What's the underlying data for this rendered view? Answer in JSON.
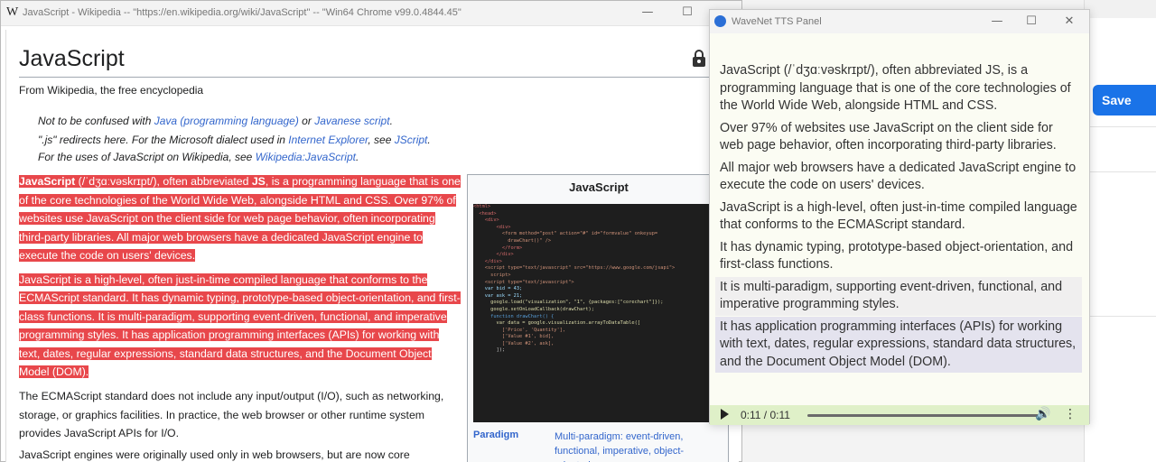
{
  "browser": {
    "window_title": "JavaScript - Wikipedia -- \"https://en.wikipedia.org/wiki/JavaScript\" -- \"Win64 Chrome v99.0.4844.45\"",
    "logo_letter": "W",
    "min_glyph": "—",
    "max_glyph": "☐"
  },
  "article": {
    "title": "JavaScript",
    "subtitle": "From Wikipedia, the free encyclopedia",
    "hatnote1": {
      "pre": "Not to be confused with ",
      "link1": "Java (programming language)",
      "mid": " or ",
      "link2": "Javanese script",
      "post": "."
    },
    "hatnote2": {
      "pre": "\".js\" redirects here. For the Microsoft dialect used in ",
      "link1": "Internet Explorer",
      "mid": ", see ",
      "link2": "JScript",
      "post": "."
    },
    "hatnote3": {
      "pre": "For the uses of JavaScript on Wikipedia, see ",
      "link1": "Wikipedia:JavaScript",
      "post": "."
    },
    "lead1": {
      "b1": "JavaScript",
      "t1": " (/ˈdʒɑːvəskrɪpt/), often abbreviated ",
      "b2": "JS",
      "t2": ", is a programming language that is one of the core technologies of the World Wide Web, alongside HTML and CSS. Over 97% of websites use JavaScript on the client side for web page behavior, often incorporating third-party libraries. All major web browsers have a dedicated JavaScript engine to execute the code on users' devices."
    },
    "lead2": "JavaScript is a high-level, often just-in-time compiled language that conforms to the ECMAScript standard. It has dynamic typing, prototype-based object-orientation, and first-class functions. It is multi-paradigm, supporting event-driven, functional, and imperative programming styles. It has application programming interfaces (APIs) for working with text, dates, regular expressions, standard data structures, and the Document Object Model (DOM).",
    "para3": {
      "t1": "The ECMAScript standard does not include any ",
      "l1": "input/output",
      "t2": " (I/O), such as ",
      "l2": "networking",
      "t3": ", ",
      "l3": "storage",
      "t4": ", or ",
      "l4": "graphics",
      "t5": " facilities. In practice, the web browser or other ",
      "l5": "runtime system",
      "t6": " provides JavaScript APIs for I/O."
    },
    "para4": "JavaScript engines were originally used only in web browsers, but are now core",
    "infobox": {
      "title": "JavaScript",
      "label": "Paradigm",
      "value": "Multi-paradigm: event-driven, functional, imperative, object-oriented"
    },
    "code_lines": [
      {
        "t": "<html>",
        "c": "#d16969"
      },
      {
        "t": "  <head>",
        "c": "#d16969"
      },
      {
        "t": "    <div>",
        "c": "#d16969"
      },
      {
        "t": "",
        "c": "#ccc"
      },
      {
        "t": "        <div>",
        "c": "#d16969"
      },
      {
        "t": "",
        "c": "#ccc"
      },
      {
        "t": "",
        "c": "#ccc"
      },
      {
        "t": "          <form method=\"post\" action=\"#\" id=\"formvalue\" onkeyup=",
        "c": "#ce9178"
      },
      {
        "t": "            drawChart()\" />",
        "c": "#ce9178"
      },
      {
        "t": "",
        "c": "#ccc"
      },
      {
        "t": "          </form>",
        "c": "#d16969"
      },
      {
        "t": "        </div>",
        "c": "#d16969"
      },
      {
        "t": "    </div>",
        "c": "#d16969"
      },
      {
        "t": "",
        "c": "#ccc"
      },
      {
        "t": "",
        "c": "#ccc"
      },
      {
        "t": "",
        "c": "#ccc"
      },
      {
        "t": "    <script type=\"text/javascript\" src=\"https://www.google.com/jsapi\">",
        "c": "#ce9178"
      },
      {
        "t": "      script>",
        "c": "#ce9178"
      },
      {
        "t": "    <script type=\"text/javascript\">",
        "c": "#ce9178"
      },
      {
        "t": "",
        "c": "#ccc"
      },
      {
        "t": "    var bid = 43;",
        "c": "#9cdcfe"
      },
      {
        "t": "    var ask = 21;",
        "c": "#9cdcfe"
      },
      {
        "t": "",
        "c": "#ccc"
      },
      {
        "t": "",
        "c": "#ccc"
      },
      {
        "t": "      google.load(\"visualization\", \"1\", {packages:[\"corechart\"]});",
        "c": "#dcdcaa"
      },
      {
        "t": "      google.setOnLoadCallback(drawChart);",
        "c": "#dcdcaa"
      },
      {
        "t": "      function drawChart() {",
        "c": "#569cd6"
      },
      {
        "t": "        var data = google.visualization.arrayToDataTable([",
        "c": "#dcdcaa"
      },
      {
        "t": "          ['Price', 'Quantity'],",
        "c": "#ce9178"
      },
      {
        "t": "          ['Value #1', bid],",
        "c": "#ce9178"
      },
      {
        "t": "          ['Value #2', ask],",
        "c": "#ce9178"
      },
      {
        "t": "        ]);",
        "c": "#ccc"
      }
    ]
  },
  "tts": {
    "title": "WaveNet TTS Panel",
    "sentences": [
      "JavaScript (/ˈdʒɑːvəskrɪpt/), often abbreviated JS, is a programming language that is one of the core technologies of the World Wide Web, alongside HTML and CSS.",
      "Over 97% of websites use JavaScript on the client side for web page behavior, often incorporating third-party libraries.",
      "All major web browsers have a dedicated JavaScript engine to execute the code on users' devices.",
      "JavaScript is a high-level, often just-in-time compiled language that conforms to the ECMAScript standard.",
      "It has dynamic typing, prototype-based object-orientation, and first-class functions.",
      "It is multi-paradigm, supporting event-driven, functional, and imperative programming styles.",
      "It has application programming interfaces (APIs) for working with text, dates, regular expressions, standard data structures, and the Document Object Model (DOM)."
    ],
    "player": {
      "time": "0:11 / 0:11",
      "progress": 1.0
    }
  },
  "background_app": {
    "save_label": "Save"
  },
  "colors": {
    "highlight": "#e8474b",
    "link": "#3366cc",
    "player_bg": "#dff0c8",
    "save_button": "#1a73e8"
  }
}
